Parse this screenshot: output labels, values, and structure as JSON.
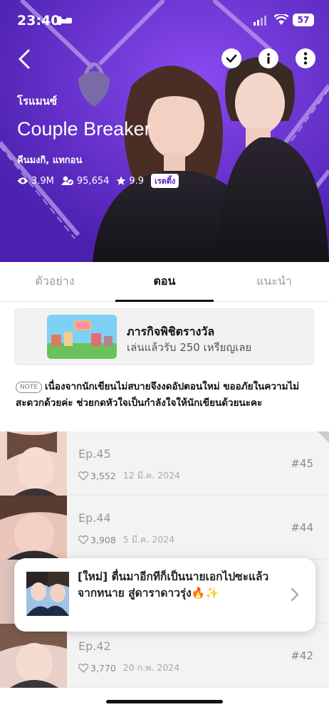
{
  "status": {
    "time": "23:40",
    "battery": "57"
  },
  "series": {
    "genre": "โรแมนซ์",
    "title": "Couple Breaker",
    "authors": "คีนมงกิ, แทกอน",
    "views": "3.9M",
    "subscribers": "95,654",
    "rating": "9.9",
    "rate_label": "เรตติ้ง"
  },
  "tabs": [
    {
      "label": "ตัวอย่าง"
    },
    {
      "label": "ตอน"
    },
    {
      "label": "แนะนำ"
    }
  ],
  "mission": {
    "title": "ภารกิจพิชิตรางวัล",
    "subtitle": "เล่นแล้วรับ 250 เหรียญเลย"
  },
  "notice": {
    "badge": "NOTE",
    "text": "เนื่องจากนักเขียนไม่สบายจึงงดอัปตอนใหม่ ขออภัยในความไม่สะดวกด้วยค่ะ ช่วยกดหัวใจเป็นกำลังใจให้นักเขียนด้วยนะคะ"
  },
  "episodes": [
    {
      "title": "Ep.45",
      "likes": "3,552",
      "date": "12 มี.ค. 2024",
      "num": "#45"
    },
    {
      "title": "Ep.44",
      "likes": "3,908",
      "date": "5 มี.ค. 2024",
      "num": "#44"
    },
    {
      "title": "Ep.42",
      "likes": "3,770",
      "date": "20 ก.พ. 2024",
      "num": "#42"
    }
  ],
  "popup": {
    "line1": "[ใหม่] ตื่นมาอีกทีก็เป็นนายเอกไปซะแล้ว",
    "line2": "จากทนาย สู่ดาราดาวรุ่ง🔥✨"
  },
  "colors": {
    "hero": "#5a26c9",
    "accent": "#111111"
  }
}
